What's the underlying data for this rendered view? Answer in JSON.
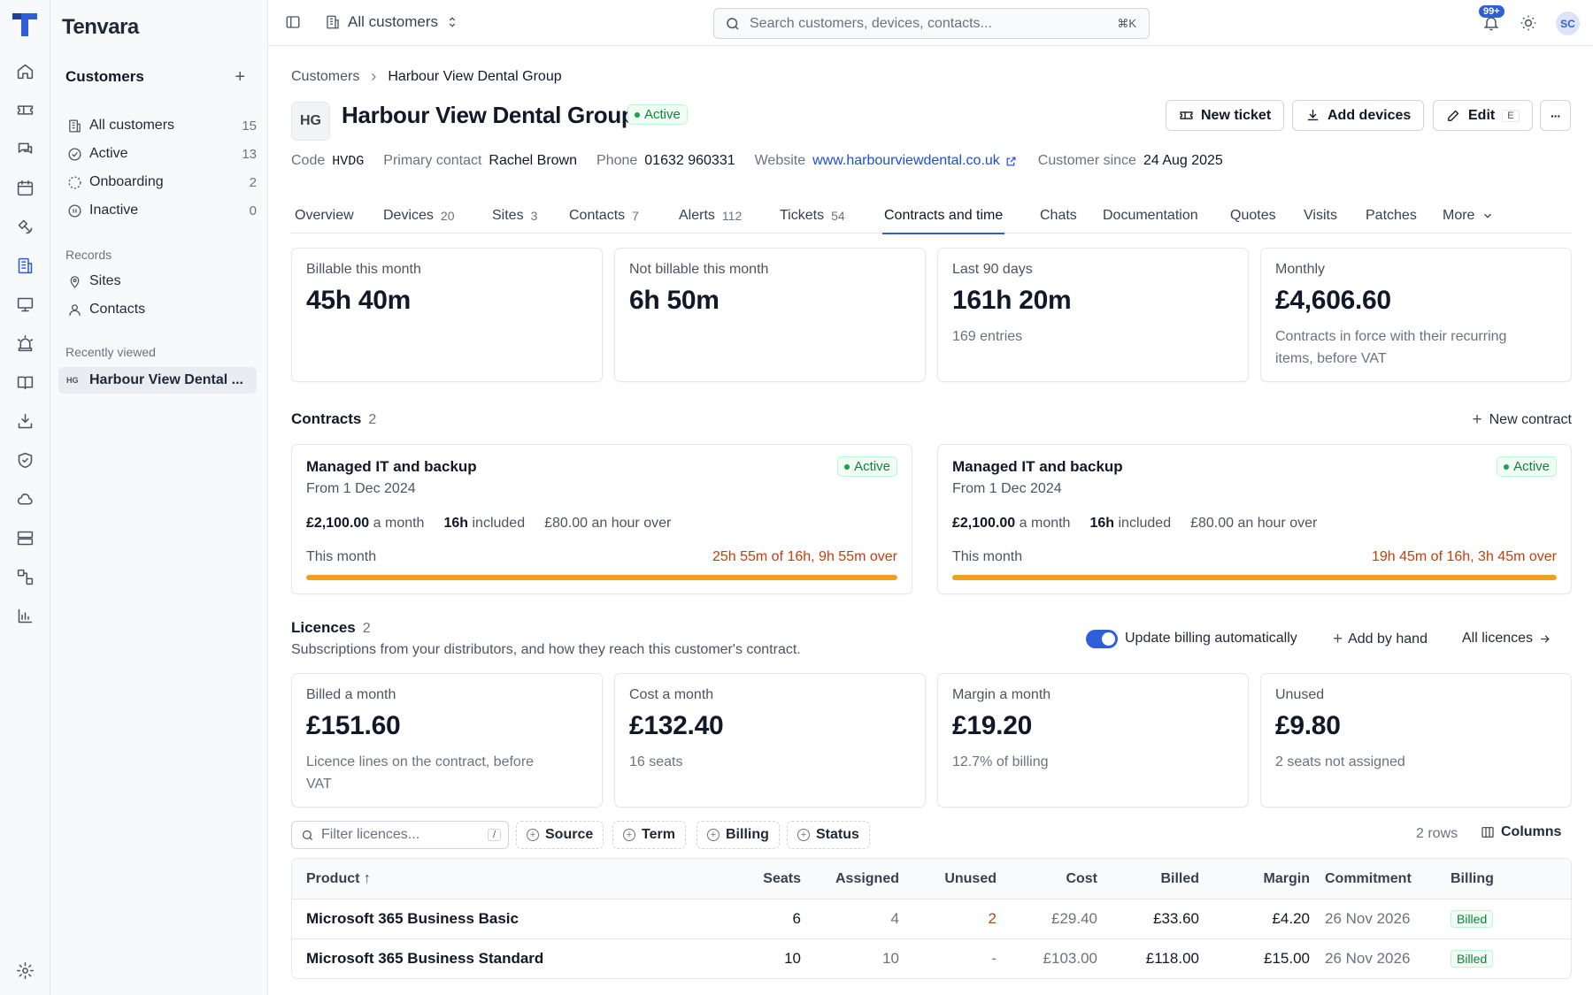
{
  "app": {
    "name": "Tenvara"
  },
  "sidebar": {
    "heading": "Customers",
    "add_label": "+",
    "items": [
      {
        "label": "All customers",
        "count": "15"
      },
      {
        "label": "Active",
        "count": "13"
      },
      {
        "label": "Onboarding",
        "count": "2"
      },
      {
        "label": "Inactive",
        "count": "0"
      }
    ],
    "records_label": "Records",
    "records": [
      {
        "label": "Sites"
      },
      {
        "label": "Contacts"
      }
    ],
    "recent_label": "Recently viewed",
    "recent": [
      {
        "tag": "HG",
        "label": "Harbour View Dental ..."
      }
    ]
  },
  "topbar": {
    "scope": "All customers",
    "search_placeholder": "Search customers, devices, contacts...",
    "search_kbd": "⌘K",
    "notifications": "99+",
    "avatar": "SC"
  },
  "breadcrumb": {
    "root": "Customers",
    "current": "Harbour View Dental Group"
  },
  "customer": {
    "initials": "HG",
    "name": "Harbour View Dental Group",
    "status": "Active",
    "meta": {
      "code_label": "Code",
      "code": "HVDG",
      "contact_label": "Primary contact",
      "contact": "Rachel Brown",
      "phone_label": "Phone",
      "phone": "01632 960331",
      "website_label": "Website",
      "website": "www.harbourviewdental.co.uk",
      "since_label": "Customer since",
      "since": "24 Aug 2025"
    }
  },
  "actions": {
    "new_ticket": "New ticket",
    "add_devices": "Add devices",
    "edit": "Edit",
    "edit_key": "E",
    "more": "···"
  },
  "tabs": [
    {
      "label": "Overview",
      "count": ""
    },
    {
      "label": "Devices",
      "count": "20"
    },
    {
      "label": "Sites",
      "count": "3"
    },
    {
      "label": "Contacts",
      "count": "7"
    },
    {
      "label": "Alerts",
      "count": "112"
    },
    {
      "label": "Tickets",
      "count": "54"
    },
    {
      "label": "Contracts and time",
      "count": "",
      "active": true
    },
    {
      "label": "Chats",
      "count": ""
    },
    {
      "label": "Documentation",
      "count": ""
    },
    {
      "label": "Quotes",
      "count": ""
    },
    {
      "label": "Visits",
      "count": ""
    },
    {
      "label": "Patches",
      "count": ""
    },
    {
      "label": "More",
      "count": ""
    }
  ],
  "time_stats": [
    {
      "label": "Billable this month",
      "value": "45h 40m",
      "sub": ""
    },
    {
      "label": "Not billable this month",
      "value": "6h 50m",
      "sub": ""
    },
    {
      "label": "Last 90 days",
      "value": "161h 20m",
      "sub": "169 entries"
    },
    {
      "label": "Monthly",
      "value": "£4,606.60",
      "sub": "Contracts in force with their recurring items, before VAT"
    }
  ],
  "contracts": {
    "title": "Contracts",
    "count": "2",
    "new_label": "New contract",
    "items": [
      {
        "name": "Managed IT and backup",
        "from": "From 1 Dec 2024",
        "status": "Active",
        "price": "£2,100.00",
        "price_unit": "a month",
        "hours": "16h",
        "hours_unit": "included",
        "overage": "£80.00 an hour over",
        "month_label": "This month",
        "usage": "25h 55m of 16h, 9h 55m over",
        "progress": 1.0
      },
      {
        "name": "Managed IT and backup",
        "from": "From 1 Dec 2024",
        "status": "Active",
        "price": "£2,100.00",
        "price_unit": "a month",
        "hours": "16h",
        "hours_unit": "included",
        "overage": "£80.00 an hour over",
        "month_label": "This month",
        "usage": "19h 45m of 16h, 3h 45m over",
        "progress": 1.0
      }
    ]
  },
  "licences": {
    "title": "Licences",
    "count": "2",
    "subtitle": "Subscriptions from your distributors, and how they reach this customer's contract.",
    "auto_billing": "Update billing automatically",
    "add_by_hand": "Add by hand",
    "all_licences": "All licences",
    "stats": [
      {
        "label": "Billed a month",
        "value": "£151.60",
        "sub": "Licence lines on the contract, before VAT"
      },
      {
        "label": "Cost a month",
        "value": "£132.40",
        "sub": "16 seats"
      },
      {
        "label": "Margin a month",
        "value": "£19.20",
        "sub": "12.7% of billing"
      },
      {
        "label": "Unused",
        "value": "£9.80",
        "sub": "2 seats not assigned"
      }
    ],
    "filter_placeholder": "Filter licences...",
    "filter_key": "/",
    "chips": [
      "Source",
      "Term",
      "Billing",
      "Status"
    ],
    "rows_label": "2 rows",
    "columns_label": "Columns",
    "headers": {
      "product": "Product ↑",
      "seats": "Seats",
      "assigned": "Assigned",
      "unused": "Unused",
      "cost": "Cost",
      "billed": "Billed",
      "margin": "Margin",
      "commitment": "Commitment",
      "billing": "Billing"
    },
    "rows": [
      {
        "product": "Microsoft 365 Business Basic",
        "seats": "6",
        "assigned": "4",
        "unused": "2",
        "cost": "£29.40",
        "billed": "£33.60",
        "margin": "£4.20",
        "commitment": "26 Nov 2026",
        "billing": "Billed"
      },
      {
        "product": "Microsoft 365 Business Standard",
        "seats": "10",
        "assigned": "10",
        "unused": "-",
        "cost": "£103.00",
        "billed": "£118.00",
        "margin": "£15.00",
        "commitment": "26 Nov 2026",
        "billing": "Billed"
      }
    ]
  },
  "colors": {
    "accent": "#2f5fd8",
    "active_green": "#15803d",
    "overage_orange": "#c2410c",
    "progress_orange": "#f0a020"
  }
}
